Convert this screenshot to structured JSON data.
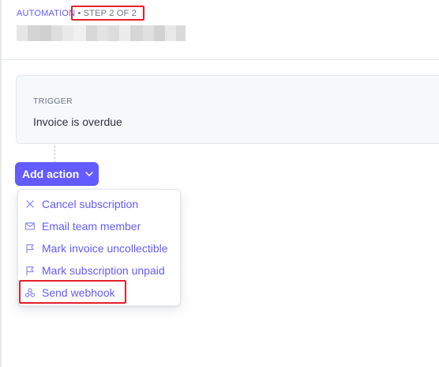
{
  "header": {
    "breadcrumb_root": "AUTOMATION",
    "breadcrumb_step": "• STEP 2 OF 2"
  },
  "trigger": {
    "label": "TRIGGER",
    "value": "Invoice is overdue"
  },
  "add_action": {
    "label": "Add action",
    "icon": "chevron-down-icon"
  },
  "menu": {
    "items": [
      {
        "label": "Cancel subscription",
        "icon": "close-icon"
      },
      {
        "label": "Email team member",
        "icon": "mail-icon"
      },
      {
        "label": "Mark invoice uncollectible",
        "icon": "flag-icon"
      },
      {
        "label": "Mark subscription unpaid",
        "icon": "flag-icon"
      },
      {
        "label": "Send webhook",
        "icon": "webhook-icon"
      }
    ]
  },
  "colors": {
    "accent": "#635bff",
    "highlight": "#e5212d",
    "text": "#30313d",
    "muted": "#6a7383"
  }
}
